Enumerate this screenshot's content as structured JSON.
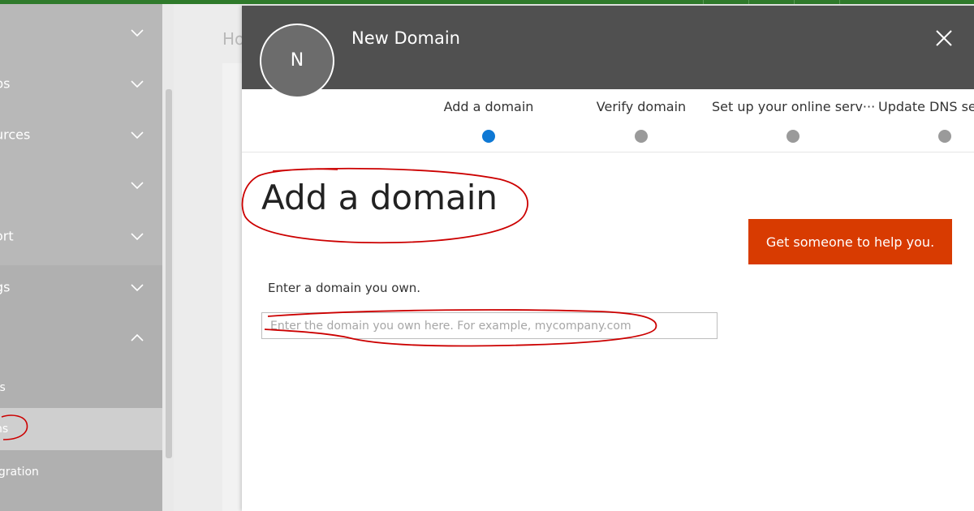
{
  "nav": {
    "items": [
      {
        "label": ""
      },
      {
        "label": "ps"
      },
      {
        "label": "urces"
      },
      {
        "label": ""
      },
      {
        "label": "ort"
      },
      {
        "label": "gs"
      },
      {
        "label": ""
      }
    ],
    "subitems": [
      {
        "label": "ts"
      },
      {
        "label": "ns"
      },
      {
        "label": "igration"
      }
    ]
  },
  "background": {
    "breadcrumb": "Ho"
  },
  "panel": {
    "avatar_initial": "N",
    "title": "New Domain",
    "steps": [
      {
        "label": "Add a domain",
        "active": true
      },
      {
        "label": "Verify domain",
        "active": false
      },
      {
        "label": "Set up your online serv···",
        "active": false
      },
      {
        "label": "Update DNS se",
        "active": false
      }
    ],
    "heading": "Add a domain",
    "help_button": "Get someone to help you.",
    "field_label": "Enter a domain you own.",
    "domain_input": {
      "value": "",
      "placeholder": "Enter the domain you own here. For example, mycompany.com"
    }
  },
  "colors": {
    "topbar": "#2f7a2b",
    "header": "#505050",
    "active_step": "#0e78d4",
    "help_button": "#d83b01",
    "annotation": "#cc0000"
  }
}
